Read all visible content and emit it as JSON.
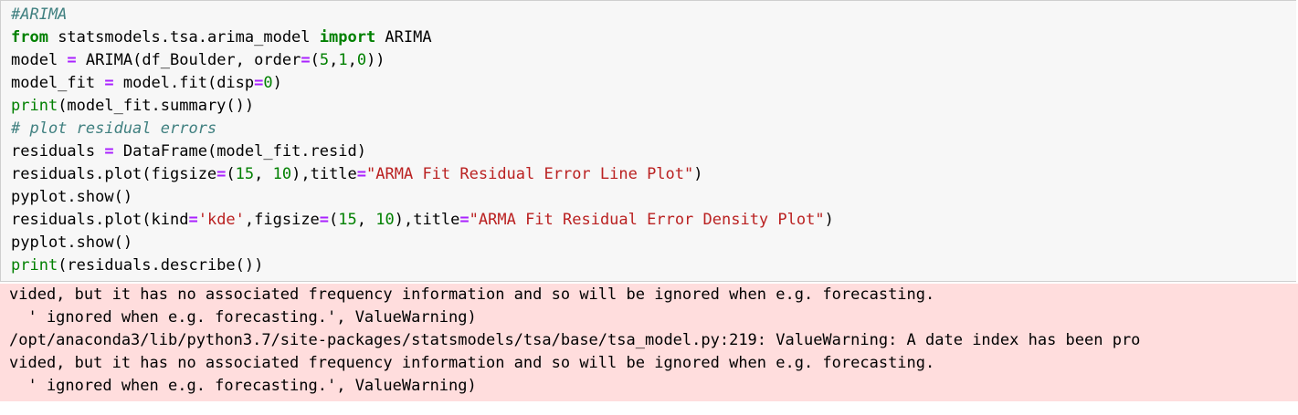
{
  "code_cell": {
    "lines": [
      [
        {
          "t": "#ARIMA",
          "c": "cm"
        }
      ],
      [
        {
          "t": "from",
          "c": "kw"
        },
        {
          "t": " statsmodels.tsa.arima_model ",
          "c": ""
        },
        {
          "t": "import",
          "c": "kw"
        },
        {
          "t": " ARIMA",
          "c": ""
        }
      ],
      [
        {
          "t": "model ",
          "c": ""
        },
        {
          "t": "=",
          "c": "op"
        },
        {
          "t": " ARIMA(df_Boulder, order",
          "c": ""
        },
        {
          "t": "=",
          "c": "op"
        },
        {
          "t": "(",
          "c": ""
        },
        {
          "t": "5",
          "c": "num"
        },
        {
          "t": ",",
          "c": ""
        },
        {
          "t": "1",
          "c": "num"
        },
        {
          "t": ",",
          "c": ""
        },
        {
          "t": "0",
          "c": "num"
        },
        {
          "t": "))",
          "c": ""
        }
      ],
      [
        {
          "t": "model_fit ",
          "c": ""
        },
        {
          "t": "=",
          "c": "op"
        },
        {
          "t": " model.fit(disp",
          "c": ""
        },
        {
          "t": "=",
          "c": "op"
        },
        {
          "t": "0",
          "c": "num"
        },
        {
          "t": ")",
          "c": ""
        }
      ],
      [
        {
          "t": "print",
          "c": "bi"
        },
        {
          "t": "(model_fit.summary())",
          "c": ""
        }
      ],
      [
        {
          "t": "# plot residual errors",
          "c": "cm"
        }
      ],
      [
        {
          "t": "residuals ",
          "c": ""
        },
        {
          "t": "=",
          "c": "op"
        },
        {
          "t": " DataFrame(model_fit.resid)",
          "c": ""
        }
      ],
      [
        {
          "t": "residuals.plot(figsize",
          "c": ""
        },
        {
          "t": "=",
          "c": "op"
        },
        {
          "t": "(",
          "c": ""
        },
        {
          "t": "15",
          "c": "num"
        },
        {
          "t": ", ",
          "c": ""
        },
        {
          "t": "10",
          "c": "num"
        },
        {
          "t": "),title",
          "c": ""
        },
        {
          "t": "=",
          "c": "op"
        },
        {
          "t": "\"ARMA Fit Residual Error Line Plot\"",
          "c": "str"
        },
        {
          "t": ")",
          "c": ""
        }
      ],
      [
        {
          "t": "pyplot.show()",
          "c": ""
        }
      ],
      [
        {
          "t": "residuals.plot(kind",
          "c": ""
        },
        {
          "t": "=",
          "c": "op"
        },
        {
          "t": "'kde'",
          "c": "str"
        },
        {
          "t": ",figsize",
          "c": ""
        },
        {
          "t": "=",
          "c": "op"
        },
        {
          "t": "(",
          "c": ""
        },
        {
          "t": "15",
          "c": "num"
        },
        {
          "t": ", ",
          "c": ""
        },
        {
          "t": "10",
          "c": "num"
        },
        {
          "t": "),title",
          "c": ""
        },
        {
          "t": "=",
          "c": "op"
        },
        {
          "t": "\"ARMA Fit Residual Error Density Plot\"",
          "c": "str"
        },
        {
          "t": ")",
          "c": ""
        }
      ],
      [
        {
          "t": "pyplot.show()",
          "c": ""
        }
      ],
      [
        {
          "t": "print",
          "c": "bi"
        },
        {
          "t": "(residuals.describe())",
          "c": ""
        }
      ]
    ]
  },
  "output": {
    "lines": [
      "vided, but it has no associated frequency information and so will be ignored when e.g. forecasting.",
      "  ' ignored when e.g. forecasting.', ValueWarning)",
      "/opt/anaconda3/lib/python3.7/site-packages/statsmodels/tsa/base/tsa_model.py:219: ValueWarning: A date index has been pro",
      "vided, but it has no associated frequency information and so will be ignored when e.g. forecasting.",
      "  ' ignored when e.g. forecasting.', ValueWarning)"
    ]
  },
  "colors": {
    "cell_bg": "#f7f7f7",
    "stderr_bg": "#ffdddd",
    "keyword": "#008000",
    "comment": "#408080",
    "operator": "#aa22ff",
    "string": "#ba2121"
  }
}
